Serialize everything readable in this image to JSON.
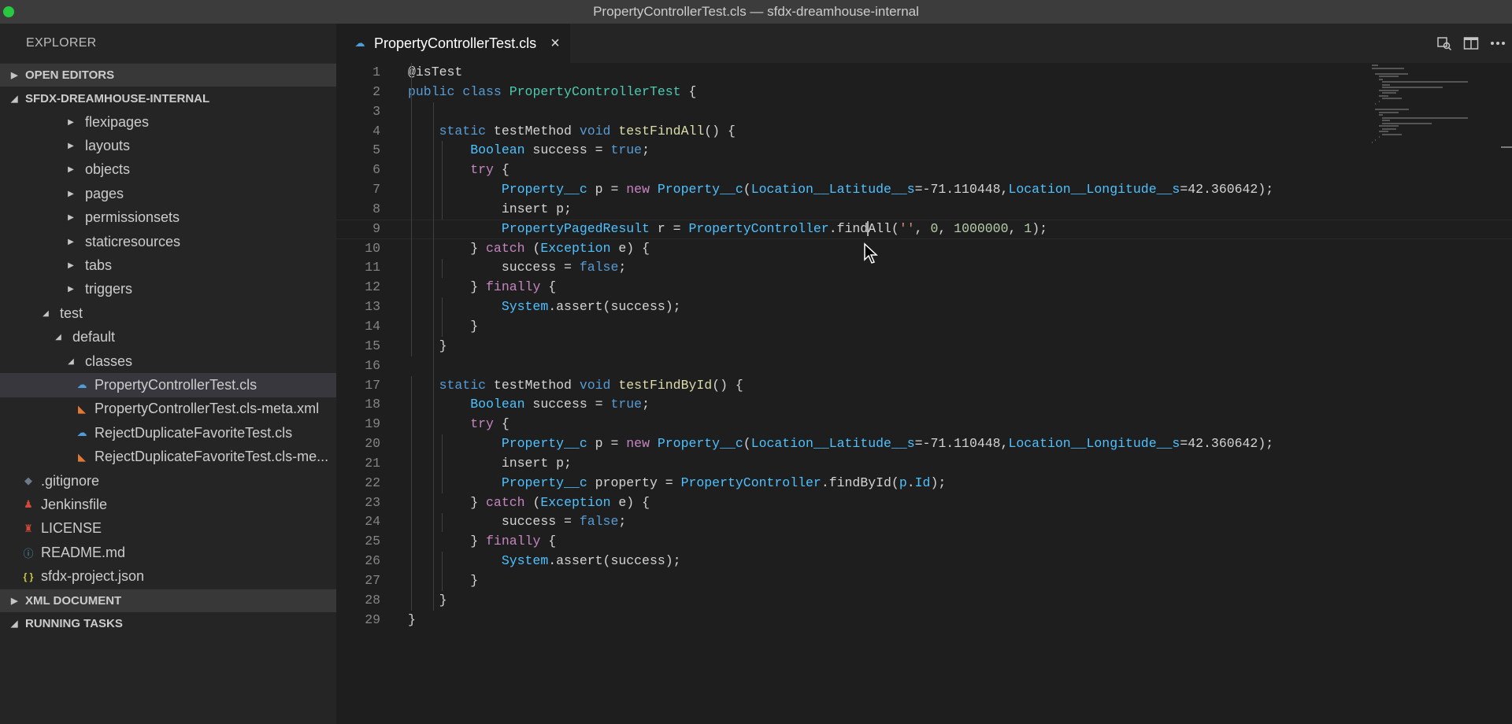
{
  "window": {
    "title": "PropertyControllerTest.cls — sfdx-dreamhouse-internal"
  },
  "sidebar": {
    "title": "EXPLORER",
    "sections": {
      "open_editors": "OPEN EDITORS",
      "project": "SFDX-DREAMHOUSE-INTERNAL",
      "xml_document": "XML DOCUMENT",
      "running_tasks": "RUNNING TASKS"
    },
    "tree": [
      {
        "label": "flexipages",
        "depth": 2,
        "kind": "folder-collapsed"
      },
      {
        "label": "layouts",
        "depth": 2,
        "kind": "folder-collapsed"
      },
      {
        "label": "objects",
        "depth": 2,
        "kind": "folder-collapsed"
      },
      {
        "label": "pages",
        "depth": 2,
        "kind": "folder-collapsed"
      },
      {
        "label": "permissionsets",
        "depth": 2,
        "kind": "folder-collapsed"
      },
      {
        "label": "staticresources",
        "depth": 2,
        "kind": "folder-collapsed"
      },
      {
        "label": "tabs",
        "depth": 2,
        "kind": "folder-collapsed"
      },
      {
        "label": "triggers",
        "depth": 2,
        "kind": "folder-collapsed"
      },
      {
        "label": "test",
        "depth": 0,
        "kind": "folder-expanded"
      },
      {
        "label": "default",
        "depth": 1,
        "kind": "folder-expanded"
      },
      {
        "label": "classes",
        "depth": 2,
        "kind": "folder-expanded"
      },
      {
        "label": "PropertyControllerTest.cls",
        "depth": 3,
        "kind": "file",
        "icon": "cloud-icon",
        "selected": true
      },
      {
        "label": "PropertyControllerTest.cls-meta.xml",
        "depth": 3,
        "kind": "file",
        "icon": "rss-icon"
      },
      {
        "label": "RejectDuplicateFavoriteTest.cls",
        "depth": 3,
        "kind": "file",
        "icon": "cloud-icon"
      },
      {
        "label": "RejectDuplicateFavoriteTest.cls-me...",
        "depth": 3,
        "kind": "file",
        "icon": "rss-icon"
      },
      {
        "label": ".gitignore",
        "depth": -1,
        "kind": "file",
        "icon": "git-icon"
      },
      {
        "label": "Jenkinsfile",
        "depth": -1,
        "kind": "file",
        "icon": "jenkins-icon"
      },
      {
        "label": "LICENSE",
        "depth": -1,
        "kind": "file",
        "icon": "license-icon"
      },
      {
        "label": "README.md",
        "depth": -1,
        "kind": "file",
        "icon": "info-icon"
      },
      {
        "label": "sfdx-project.json",
        "depth": -1,
        "kind": "file",
        "icon": "json-icon"
      }
    ]
  },
  "tab": {
    "label": "PropertyControllerTest.cls",
    "close": "×"
  },
  "editor": {
    "lines": [
      [
        [
          "@isTest",
          ""
        ]
      ],
      [
        [
          "public ",
          "kw"
        ],
        [
          "class ",
          "kw"
        ],
        [
          "PropertyControllerTest",
          "cls"
        ],
        [
          " {",
          ""
        ]
      ],
      [],
      [
        [
          "    static ",
          "kw"
        ],
        [
          "testMethod ",
          ""
        ],
        [
          "void ",
          "kw"
        ],
        [
          "testFindAll",
          "fn"
        ],
        [
          "() {",
          ""
        ]
      ],
      [
        [
          "        Boolean",
          "ty"
        ],
        [
          " success = ",
          ""
        ],
        [
          "true",
          "kw"
        ],
        [
          ";",
          ""
        ]
      ],
      [
        [
          "        try",
          "ctl"
        ],
        [
          " {",
          ""
        ]
      ],
      [
        [
          "            Property__c",
          "ty"
        ],
        [
          " p = ",
          ""
        ],
        [
          "new ",
          "ctl"
        ],
        [
          "Property__c",
          "ty"
        ],
        [
          "(",
          ""
        ],
        [
          "Location__Latitude__s",
          "ty"
        ],
        [
          "=-71.110448,",
          ""
        ],
        [
          "Location__Longitude__s",
          "ty"
        ],
        [
          "=42.360642);",
          ""
        ]
      ],
      [
        [
          "            insert p;",
          ""
        ]
      ],
      [
        [
          "            PropertyPagedResult",
          "ty"
        ],
        [
          " r = ",
          ""
        ],
        [
          "PropertyController",
          "ty"
        ],
        [
          ".find",
          ""
        ],
        [
          "CARET",
          ""
        ],
        [
          "All(",
          ""
        ],
        [
          "''",
          "str"
        ],
        [
          ", ",
          ""
        ],
        [
          "0",
          "num"
        ],
        [
          ", ",
          ""
        ],
        [
          "1000000",
          "num"
        ],
        [
          ", ",
          ""
        ],
        [
          "1",
          "num"
        ],
        [
          ");",
          ""
        ]
      ],
      [
        [
          "        } ",
          ""
        ],
        [
          "catch",
          "ctl"
        ],
        [
          " (",
          ""
        ],
        [
          "Exception",
          "ty"
        ],
        [
          " e) {",
          ""
        ]
      ],
      [
        [
          "            success = ",
          ""
        ],
        [
          "false",
          "kw"
        ],
        [
          ";",
          ""
        ]
      ],
      [
        [
          "        } ",
          ""
        ],
        [
          "finally",
          "ctl"
        ],
        [
          " {",
          ""
        ]
      ],
      [
        [
          "            System",
          "ty"
        ],
        [
          ".assert(success);",
          ""
        ]
      ],
      [
        [
          "        }",
          ""
        ]
      ],
      [
        [
          "    }",
          ""
        ]
      ],
      [],
      [
        [
          "    static ",
          "kw"
        ],
        [
          "testMethod ",
          ""
        ],
        [
          "void ",
          "kw"
        ],
        [
          "testFindById",
          "fn"
        ],
        [
          "() {",
          ""
        ]
      ],
      [
        [
          "        Boolean",
          "ty"
        ],
        [
          " success = ",
          ""
        ],
        [
          "true",
          "kw"
        ],
        [
          ";",
          ""
        ]
      ],
      [
        [
          "        try",
          "ctl"
        ],
        [
          " {",
          ""
        ]
      ],
      [
        [
          "            Property__c",
          "ty"
        ],
        [
          " p = ",
          ""
        ],
        [
          "new ",
          "ctl"
        ],
        [
          "Property__c",
          "ty"
        ],
        [
          "(",
          ""
        ],
        [
          "Location__Latitude__s",
          "ty"
        ],
        [
          "=-71.110448,",
          ""
        ],
        [
          "Location__Longitude__s",
          "ty"
        ],
        [
          "=42.360642);",
          ""
        ]
      ],
      [
        [
          "            insert p;",
          ""
        ]
      ],
      [
        [
          "            Property__c",
          "ty"
        ],
        [
          " property = ",
          ""
        ],
        [
          "PropertyController",
          "ty"
        ],
        [
          ".findById(",
          ""
        ],
        [
          "p",
          "ty"
        ],
        [
          ".",
          ""
        ],
        [
          "Id",
          "ty"
        ],
        [
          ");",
          ""
        ]
      ],
      [
        [
          "        } ",
          ""
        ],
        [
          "catch",
          "ctl"
        ],
        [
          " (",
          ""
        ],
        [
          "Exception",
          "ty"
        ],
        [
          " e) {",
          ""
        ]
      ],
      [
        [
          "            success = ",
          ""
        ],
        [
          "false",
          "kw"
        ],
        [
          ";",
          ""
        ]
      ],
      [
        [
          "        } ",
          ""
        ],
        [
          "finally",
          "ctl"
        ],
        [
          " {",
          ""
        ]
      ],
      [
        [
          "            System",
          "ty"
        ],
        [
          ".assert(success);",
          ""
        ]
      ],
      [
        [
          "        }",
          ""
        ]
      ],
      [
        [
          "    }",
          ""
        ]
      ],
      [
        [
          "}",
          ""
        ]
      ]
    ],
    "line_numbers": [
      "1",
      "2",
      "3",
      "4",
      "5",
      "6",
      "7",
      "8",
      "9",
      "10",
      "11",
      "12",
      "13",
      "14",
      "15",
      "16",
      "17",
      "18",
      "19",
      "20",
      "21",
      "22",
      "23",
      "24",
      "25",
      "26",
      "27",
      "28",
      "29"
    ],
    "current_line": 9
  },
  "colors": {
    "accent": "#569cd6",
    "selection": "#37373d",
    "background": "#1e1e1e"
  }
}
